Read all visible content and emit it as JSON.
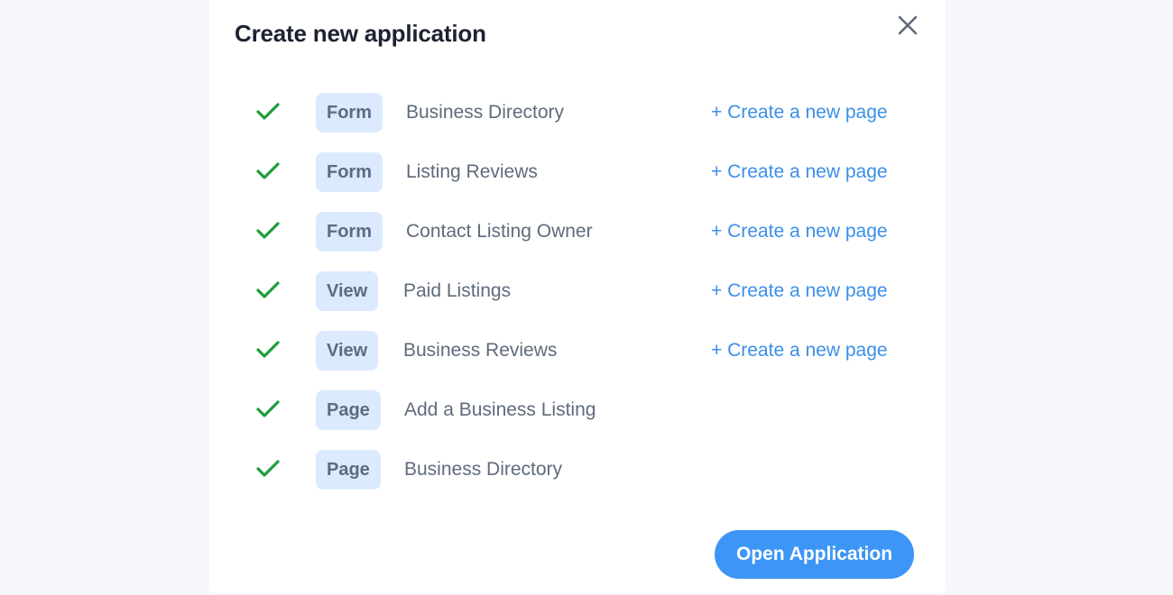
{
  "modal": {
    "title": "Create new application",
    "close_icon": "close-icon",
    "open_button_label": "Open Application"
  },
  "colors": {
    "check": "#1f9d3a",
    "badge_bg": "#dbeafe",
    "link": "#3b8fe8",
    "button": "#3d96f5"
  },
  "items": [
    {
      "type": "Form",
      "name": "Business Directory",
      "link": "+ Create a new page"
    },
    {
      "type": "Form",
      "name": "Listing Reviews",
      "link": "+ Create a new page"
    },
    {
      "type": "Form",
      "name": "Contact Listing Owner",
      "link": "+ Create a new page"
    },
    {
      "type": "View",
      "name": "Paid Listings",
      "link": "+ Create a new page"
    },
    {
      "type": "View",
      "name": "Business Reviews",
      "link": "+ Create a new page"
    },
    {
      "type": "Page",
      "name": "Add a Business Listing"
    },
    {
      "type": "Page",
      "name": "Business Directory"
    }
  ]
}
